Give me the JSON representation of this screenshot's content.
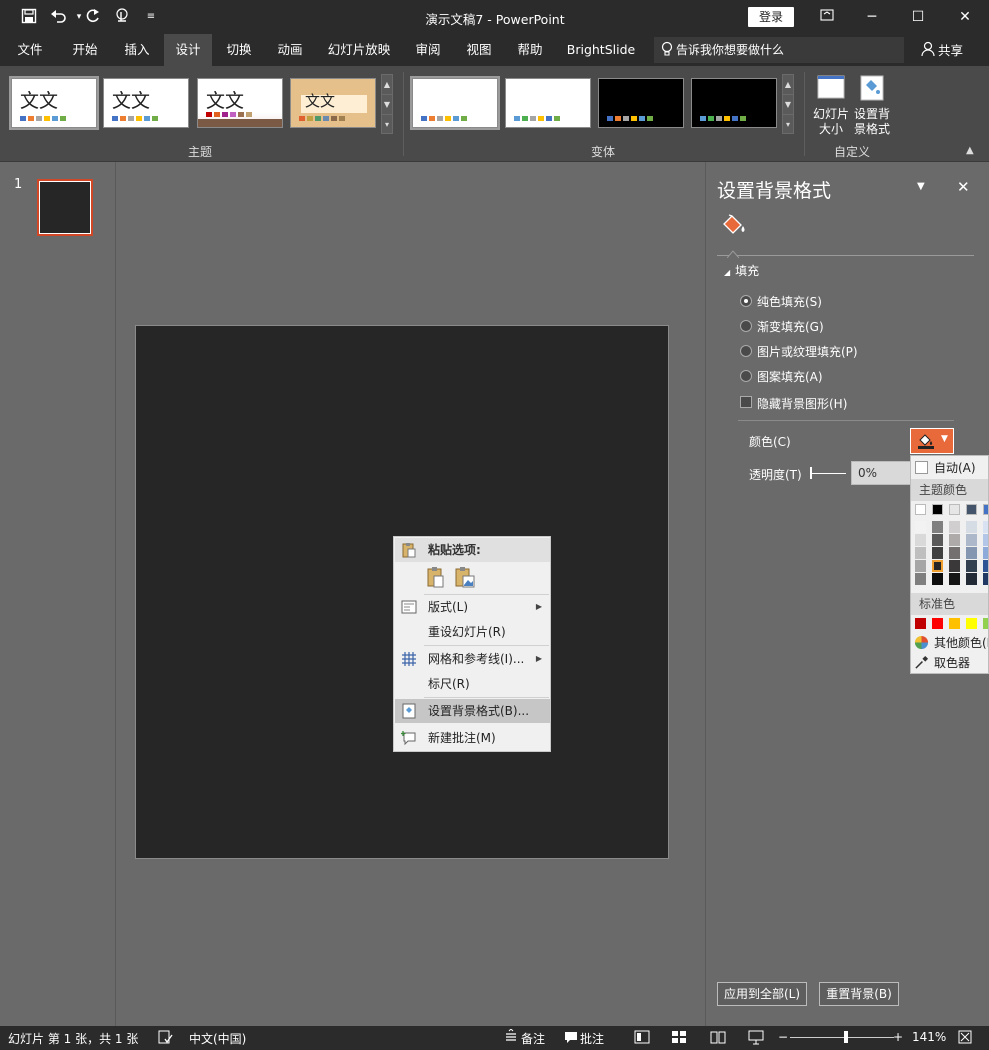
{
  "app": {
    "title": "演示文稿7  -  PowerPoint",
    "login": "登录",
    "quick_access": [
      "save",
      "undo",
      "redo",
      "touch",
      "more"
    ]
  },
  "tabs": [
    {
      "label": "文件",
      "active": false
    },
    {
      "label": "开始",
      "active": false
    },
    {
      "label": "插入",
      "active": false
    },
    {
      "label": "设计",
      "active": true
    },
    {
      "label": "切换",
      "active": false
    },
    {
      "label": "动画",
      "active": false
    },
    {
      "label": "幻灯片放映",
      "active": false
    },
    {
      "label": "审阅",
      "active": false
    },
    {
      "label": "视图",
      "active": false
    },
    {
      "label": "帮助",
      "active": false
    },
    {
      "label": "BrightSlide",
      "active": false
    }
  ],
  "tell_me": "告诉我你想要做什么",
  "share": "共享",
  "ribbon": {
    "themes_label": "主题",
    "variants_label": "变体",
    "customize_label": "自定义",
    "thumb_text": "文文",
    "slide_size": "幻灯片大小",
    "format_bg": "设置背景格式"
  },
  "thumbnail_number": "1",
  "context_menu": {
    "paste_options": "粘贴选项:",
    "layout": "版式(L)",
    "reset_slide": "重设幻灯片(R)",
    "grid_guides": "网格和参考线(I)...",
    "ruler": "标尺(R)",
    "format_background": "设置背景格式(B)...",
    "new_comment": "新建批注(M)"
  },
  "format_pane": {
    "title": "设置背景格式",
    "section_fill": "填充",
    "solid_fill": "纯色填充(S)",
    "gradient_fill": "渐变填充(G)",
    "picture_fill": "图片或纹理填充(P)",
    "pattern_fill": "图案填充(A)",
    "hide_bg_graphics": "隐藏背景图形(H)",
    "color_label": "颜色(C)",
    "transparency_label": "透明度(T)",
    "transparency_value": "0%",
    "apply_all": "应用到全部(L)",
    "reset_background": "重置背景(B)"
  },
  "color_dropdown": {
    "automatic": "自动(A)",
    "theme_colors": "主题颜色",
    "standard_colors": "标准色",
    "more_colors": "其他颜色(M)...",
    "eyedropper": "取色器",
    "theme_top_row": [
      "#ffffff",
      "#000000",
      "#e7e6e6",
      "#44546a",
      "#4472c4"
    ],
    "theme_shades": [
      [
        "#f2f2f2",
        "#7f7f7f",
        "#d0cece",
        "#d6dce4",
        "#d9e2f3"
      ],
      [
        "#d9d9d9",
        "#595959",
        "#aeaaaa",
        "#adb9ca",
        "#b4c6e7"
      ],
      [
        "#bfbfbf",
        "#3f3f3f",
        "#757070",
        "#8496b0",
        "#8eaadb"
      ],
      [
        "#a6a6a6",
        "#262626",
        "#3a3838",
        "#323f4f",
        "#2f5496"
      ],
      [
        "#7f7f7f",
        "#0d0d0d",
        "#171616",
        "#222a35",
        "#1f3864"
      ]
    ],
    "standard": [
      "#c00000",
      "#ff0000",
      "#ffc000",
      "#ffff00",
      "#92d050"
    ]
  },
  "status": {
    "slide_info": "幻灯片 第 1 张，共 1 张",
    "language": "中文(中国)",
    "notes": "备注",
    "comments": "批注",
    "zoom": "141%"
  }
}
